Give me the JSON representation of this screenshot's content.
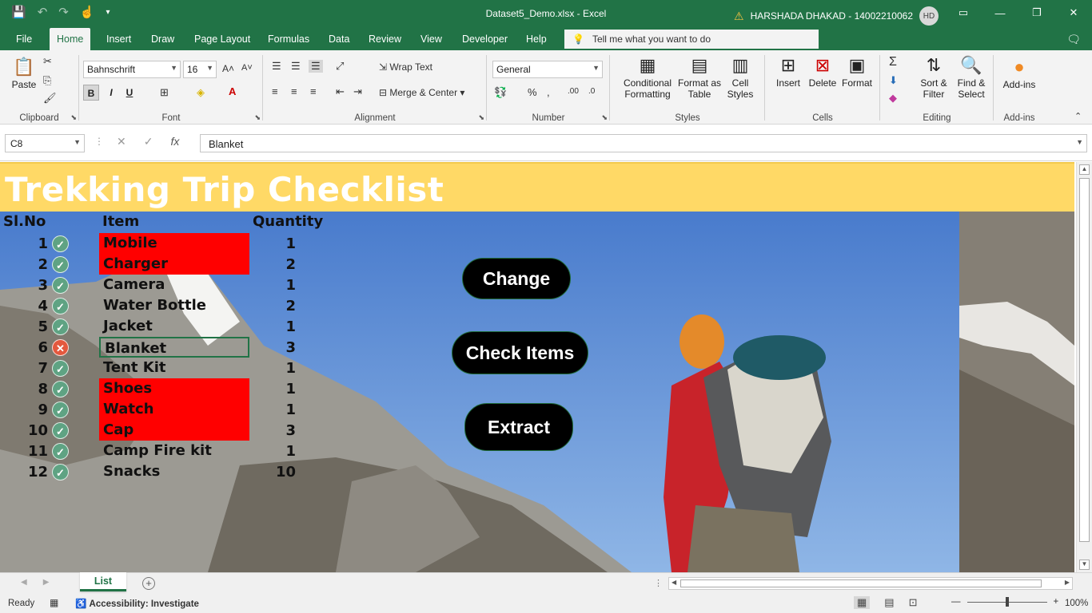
{
  "app": {
    "title": "Dataset5_Demo.xlsx  -  Excel",
    "user": "HARSHADA DHAKAD - 14002210062",
    "user_initials": "HD"
  },
  "menu": {
    "tabs": [
      "File",
      "Home",
      "Insert",
      "Draw",
      "Page Layout",
      "Formulas",
      "Data",
      "Review",
      "View",
      "Developer",
      "Help"
    ],
    "active": "Home",
    "tellme_placeholder": "Tell me what you want to do"
  },
  "ribbon": {
    "clipboard": {
      "label": "Clipboard",
      "paste": "Paste"
    },
    "font": {
      "label": "Font",
      "name": "Bahnschrift",
      "size": "16",
      "bold": "B",
      "italic": "I",
      "underline": "U"
    },
    "alignment": {
      "label": "Alignment",
      "wrap": "Wrap Text",
      "merge": "Merge & Center"
    },
    "number": {
      "label": "Number",
      "format": "General"
    },
    "styles": {
      "label": "Styles",
      "conditional": "Conditional",
      "conditional2": "Formatting",
      "format_table": "Format as",
      "format_table2": "Table",
      "cell_styles": "Cell",
      "cell_styles2": "Styles"
    },
    "cells": {
      "label": "Cells",
      "insert": "Insert",
      "delete": "Delete",
      "format": "Format"
    },
    "editing": {
      "label": "Editing",
      "sort": "Sort &",
      "sort2": "Filter",
      "find": "Find &",
      "find2": "Select"
    },
    "addins": {
      "label": "Add-ins",
      "btn": "Add-ins"
    }
  },
  "formula_bar": {
    "name_box": "C8",
    "formula": "Blanket"
  },
  "sheet": {
    "title": "Trekking Trip Checklist",
    "headers": {
      "slno": "Sl.No",
      "item": "Item",
      "quantity": "Quantity"
    },
    "rows": [
      {
        "n": "1",
        "status": "ok",
        "item": "Mobile",
        "qty": "1",
        "hl": true
      },
      {
        "n": "2",
        "status": "ok",
        "item": "Charger",
        "qty": "2",
        "hl": true
      },
      {
        "n": "3",
        "status": "ok",
        "item": "Camera",
        "qty": "1",
        "hl": false
      },
      {
        "n": "4",
        "status": "ok",
        "item": "Water Bottle",
        "qty": "2",
        "hl": false
      },
      {
        "n": "5",
        "status": "ok",
        "item": "Jacket",
        "qty": "1",
        "hl": false
      },
      {
        "n": "6",
        "status": "bad",
        "item": "Blanket",
        "qty": "3",
        "hl": false,
        "selected": true
      },
      {
        "n": "7",
        "status": "ok",
        "item": "Tent Kit",
        "qty": "1",
        "hl": false
      },
      {
        "n": "8",
        "status": "ok",
        "item": "Shoes",
        "qty": "1",
        "hl": true
      },
      {
        "n": "9",
        "status": "ok",
        "item": "Watch",
        "qty": "1",
        "hl": true
      },
      {
        "n": "10",
        "status": "ok",
        "item": "Cap",
        "qty": "3",
        "hl": true
      },
      {
        "n": "11",
        "status": "ok",
        "item": "Camp Fire kit",
        "qty": "1",
        "hl": false
      },
      {
        "n": "12",
        "status": "ok",
        "item": "Snacks",
        "qty": "10",
        "hl": false
      }
    ],
    "buttons": {
      "change": "Change",
      "check": "Check Items",
      "extract": "Extract"
    }
  },
  "sheet_tabs": {
    "active": "List"
  },
  "status_bar": {
    "ready": "Ready",
    "accessibility": "Accessibility: Investigate",
    "zoom": "100%"
  },
  "colors": {
    "excel_green": "#217346",
    "banner": "#ffd966",
    "highlight": "#ff0000",
    "ok": "#5fa383",
    "bad": "#e4583e"
  }
}
